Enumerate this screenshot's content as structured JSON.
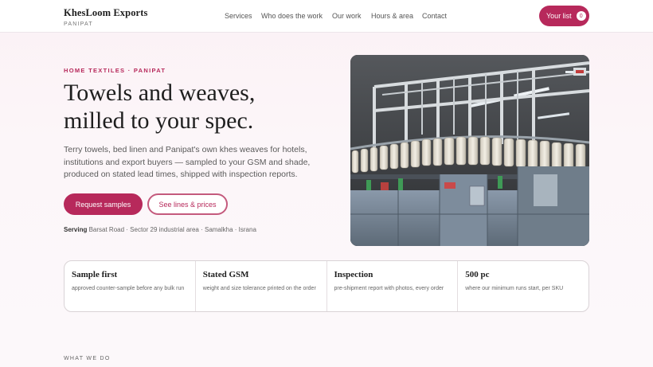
{
  "brand": {
    "name": "KhesLoom Exports",
    "location": "PANIPAT"
  },
  "nav": {
    "items": [
      "Services",
      "Who does the work",
      "Our work",
      "Hours & area",
      "Contact"
    ]
  },
  "list": {
    "label": "Your list",
    "count": "0"
  },
  "hero": {
    "eyebrow": "HOME TEXTILES · PANIPAT",
    "title_line1": "Towels and weaves,",
    "title_line2": "milled to your spec.",
    "subtitle": "Terry towels, bed linen and Panipat's own khes weaves for hotels, institutions and export buyers — sampled to your GSM and shade, produced on stated lead times, shipped with inspection reports.",
    "primary_cta": "Request samples",
    "secondary_cta": "See lines & prices",
    "serving_label": "Serving",
    "serving_areas": "Barsat Road · Sector 29 industrial area · Samalkha · Israna"
  },
  "features": [
    {
      "title": "Sample first",
      "desc": "approved counter-sample before any bulk run"
    },
    {
      "title": "Stated GSM",
      "desc": "weight and size tolerance printed on the order"
    },
    {
      "title": "Inspection",
      "desc": "pre-shipment report with photos, every order"
    },
    {
      "title": "500 pc",
      "desc": "where our minimum runs start, per SKU"
    }
  ],
  "section": {
    "label": "WHAT WE DO"
  },
  "colors": {
    "accent": "#b7295b",
    "text": "#1e1e1e"
  }
}
